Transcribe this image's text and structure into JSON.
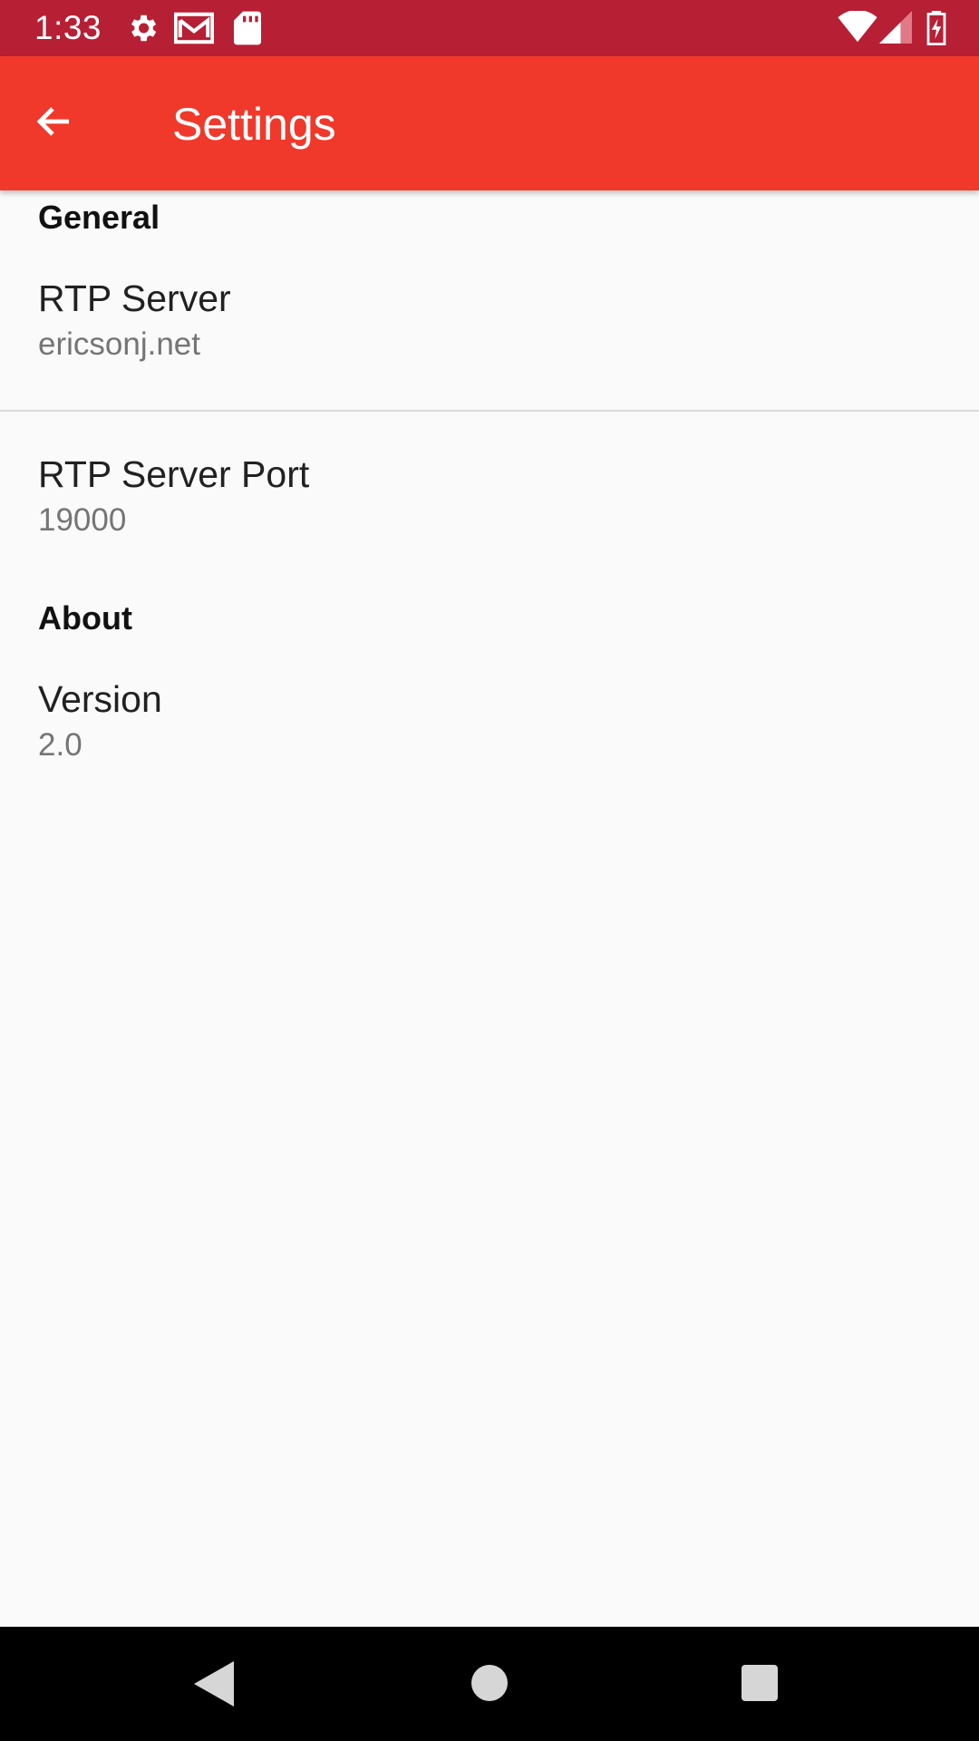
{
  "status_bar": {
    "time": "1:33",
    "icons": [
      "settings-icon",
      "gmail-icon",
      "sd-card-icon",
      "wifi-icon",
      "signal-icon",
      "battery-charging-icon"
    ]
  },
  "app_bar": {
    "title": "Settings",
    "back_icon": "arrow-back-icon",
    "color": "#f0392b",
    "status_color": "#b71f34"
  },
  "sections": {
    "general": {
      "header": "General",
      "rtp_server": {
        "title": "RTP Server",
        "summary": "ericsonj.net"
      },
      "rtp_server_port": {
        "title": "RTP Server Port",
        "summary": "19000"
      }
    },
    "about": {
      "header": "About",
      "version": {
        "title": "Version",
        "summary": "2.0"
      }
    }
  },
  "nav_bar": {
    "buttons": [
      "back-triangle-icon",
      "home-circle-icon",
      "recents-square-icon"
    ]
  }
}
